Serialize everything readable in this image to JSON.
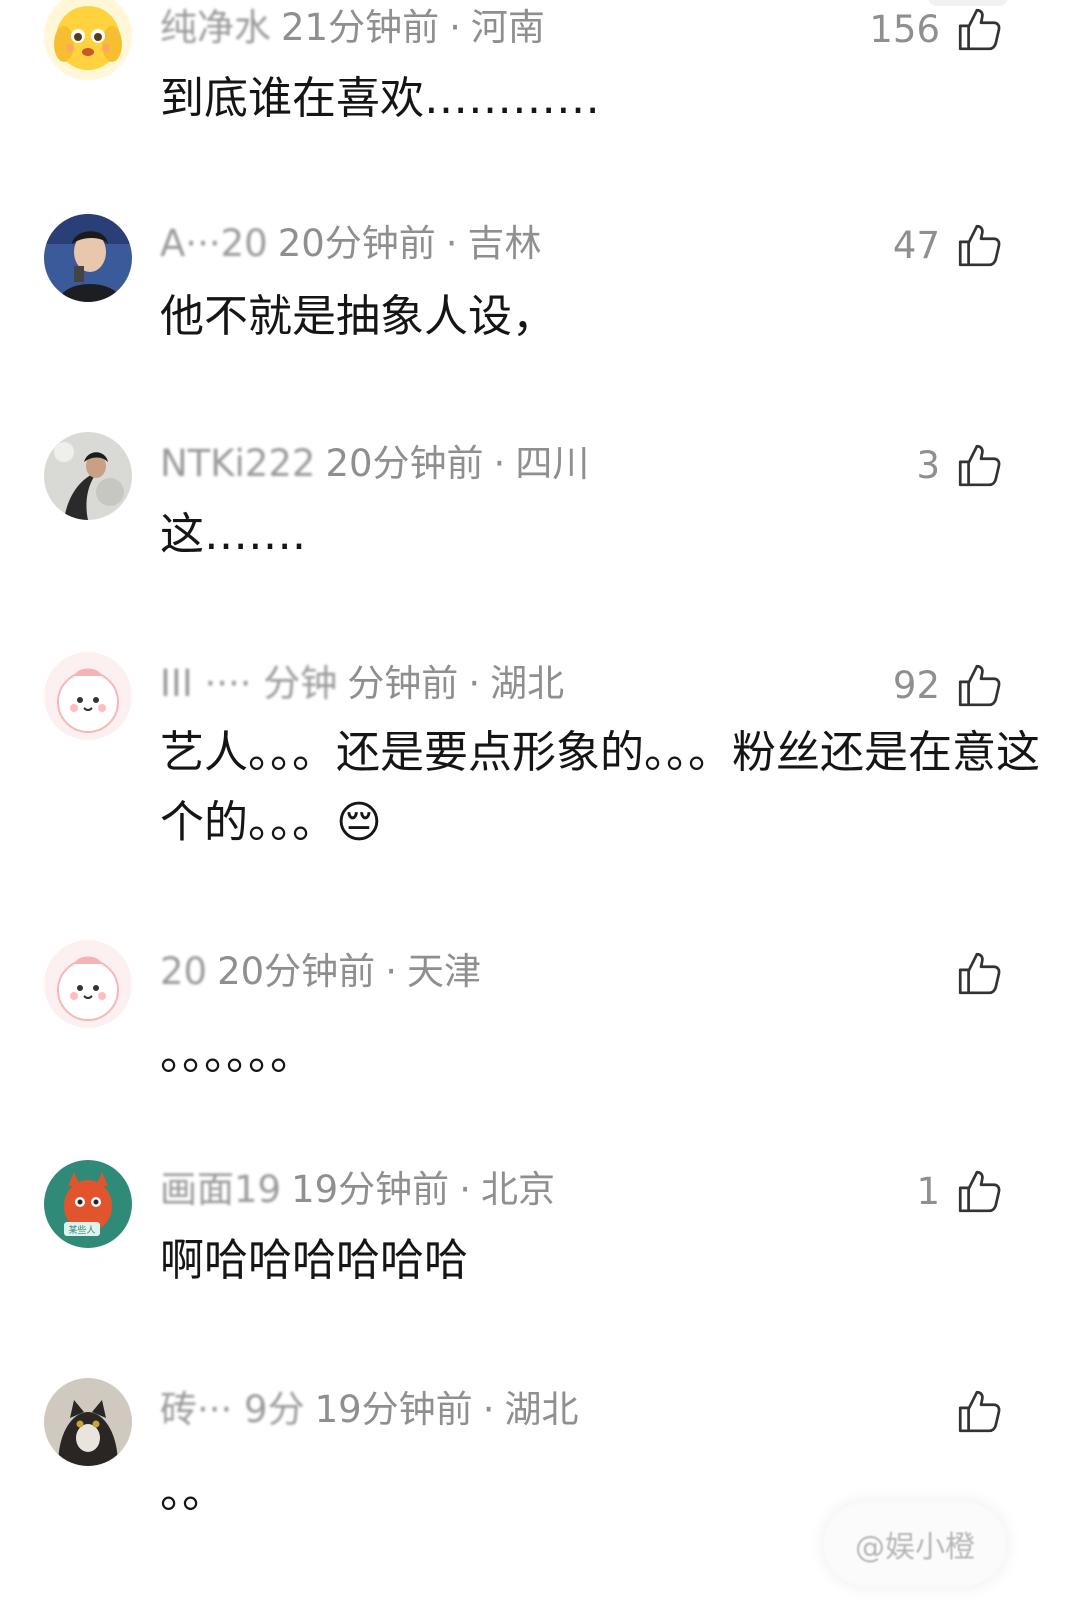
{
  "comments": [
    {
      "username": "纯净水",
      "time": "21分钟前",
      "location": "河南",
      "likes": "156",
      "text": "到底谁在喜欢…………"
    },
    {
      "username": "A···20",
      "time": "20分钟前",
      "location": "吉林",
      "likes": "47",
      "text": "他不就是抽象人设，"
    },
    {
      "username": "NTKi222",
      "time": "20分钟前",
      "location": "四川",
      "likes": "3",
      "text": "这……."
    },
    {
      "username": "III ···· 分钟",
      "time": "分钟前",
      "location": "湖北",
      "likes": "92",
      "text": "艺人。。。还是要点形象的。。。粉丝还是在意这个的。。。😔"
    },
    {
      "username": "20",
      "time": "20分钟前",
      "location": "天津",
      "likes": "",
      "text": "。。。。。。"
    },
    {
      "username": "画面19",
      "time": "19分钟前",
      "location": "北京",
      "likes": "1",
      "text": "啊哈哈哈哈哈哈"
    },
    {
      "username": "砖··· 9分",
      "time": "19分钟前",
      "location": "湖北",
      "likes": "",
      "text": "。。"
    }
  ],
  "watermark": "@娱小橙",
  "separator": "·",
  "icons": {
    "like": "thumbs-up-icon"
  }
}
